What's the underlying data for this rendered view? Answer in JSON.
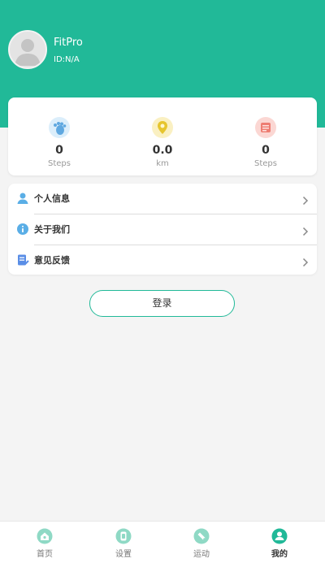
{
  "profile": {
    "name": "FitPro",
    "id": "ID:N/A"
  },
  "stats": [
    {
      "value": "0",
      "unit": "Steps",
      "icon": "footprint-icon",
      "color": "#7fb8e6"
    },
    {
      "value": "0.0",
      "unit": "km",
      "icon": "location-icon",
      "color": "#e8c93a"
    },
    {
      "value": "0",
      "unit": "Steps",
      "icon": "calorie-icon",
      "color": "#f0847a"
    }
  ],
  "menu": [
    {
      "label": "个人信息",
      "icon": "person-icon"
    },
    {
      "label": "关于我们",
      "icon": "info-icon"
    },
    {
      "label": "意见反馈",
      "icon": "feedback-icon"
    }
  ],
  "login": {
    "label": "登录"
  },
  "tabs": [
    {
      "label": "首页",
      "icon": "home-icon"
    },
    {
      "label": "设置",
      "icon": "watch-icon"
    },
    {
      "label": "运动",
      "icon": "sport-icon"
    },
    {
      "label": "我的",
      "icon": "profile-icon",
      "active": true
    }
  ],
  "colors": {
    "primary": "#21b998",
    "background": "#f4f4f4"
  }
}
